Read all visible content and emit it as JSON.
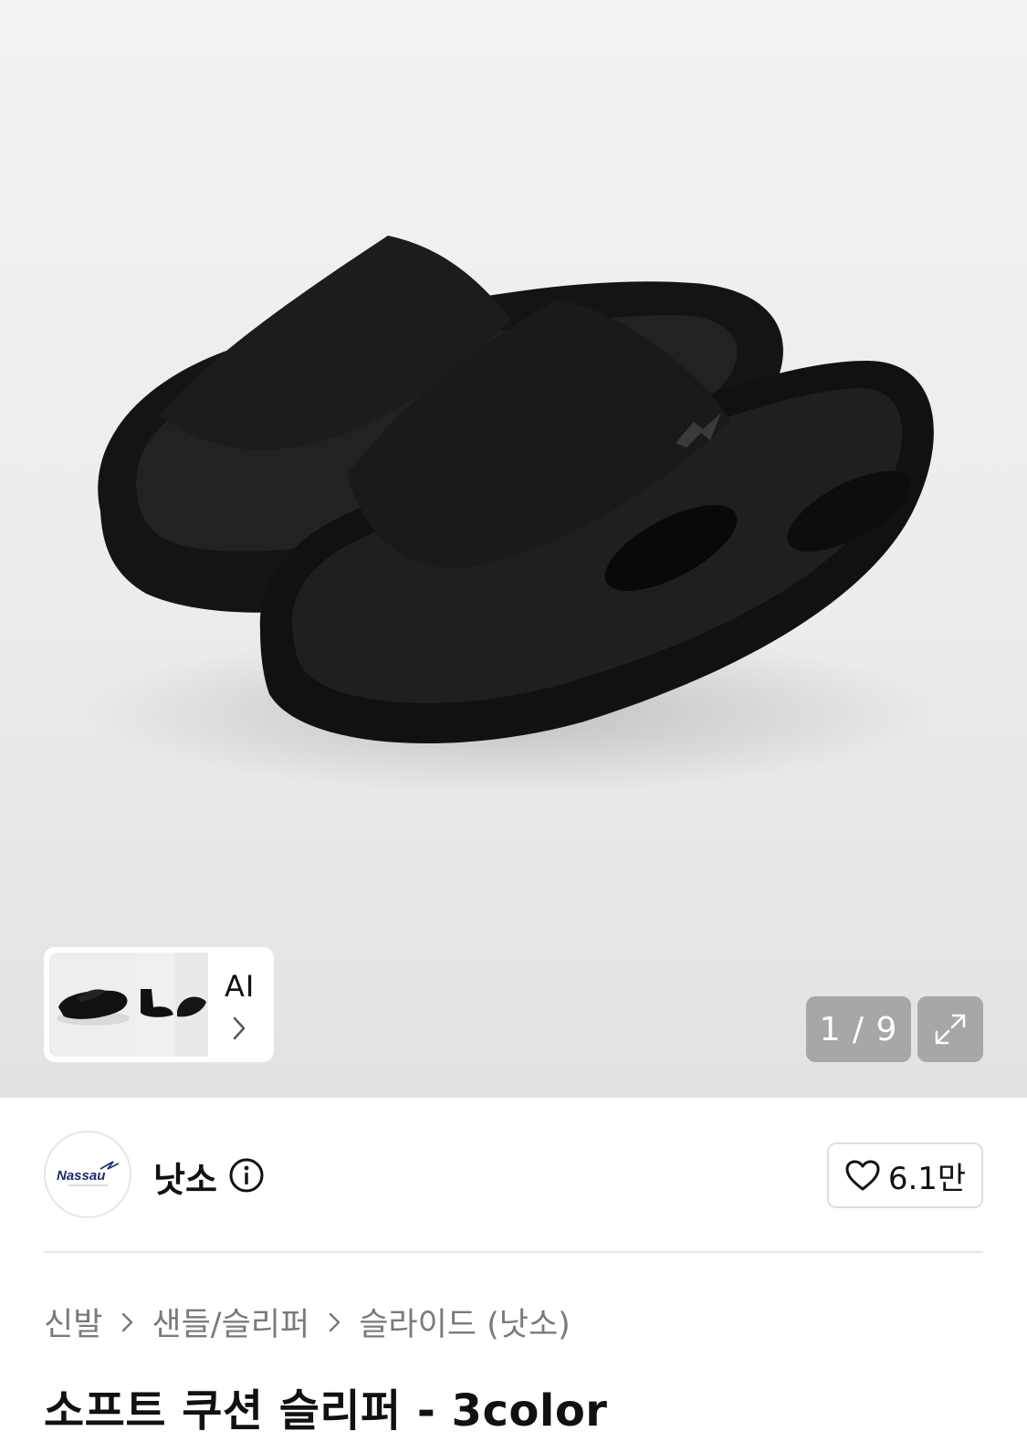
{
  "gallery": {
    "ai_label": "AI",
    "page_indicator": "1 / 9",
    "icons": {
      "expand": "expand-icon",
      "ai_chevron": "chevron-right-icon"
    }
  },
  "brand": {
    "logo_text": "Nassau",
    "name": "낫소",
    "info_icon": "info-icon"
  },
  "like": {
    "icon": "heart-icon",
    "count": "6.1만"
  },
  "breadcrumb": {
    "items": [
      "신발",
      "샌들/슬리퍼",
      "슬라이드 (낫소)"
    ],
    "separator_icon": "chevron-right-icon"
  },
  "product": {
    "title": "소프트 쿠션 슬리퍼 - 3color",
    "color": "black"
  },
  "colors": {
    "muted_text": "#7a7a7a",
    "overlay": "#969696",
    "divider": "#e6e6e6"
  }
}
